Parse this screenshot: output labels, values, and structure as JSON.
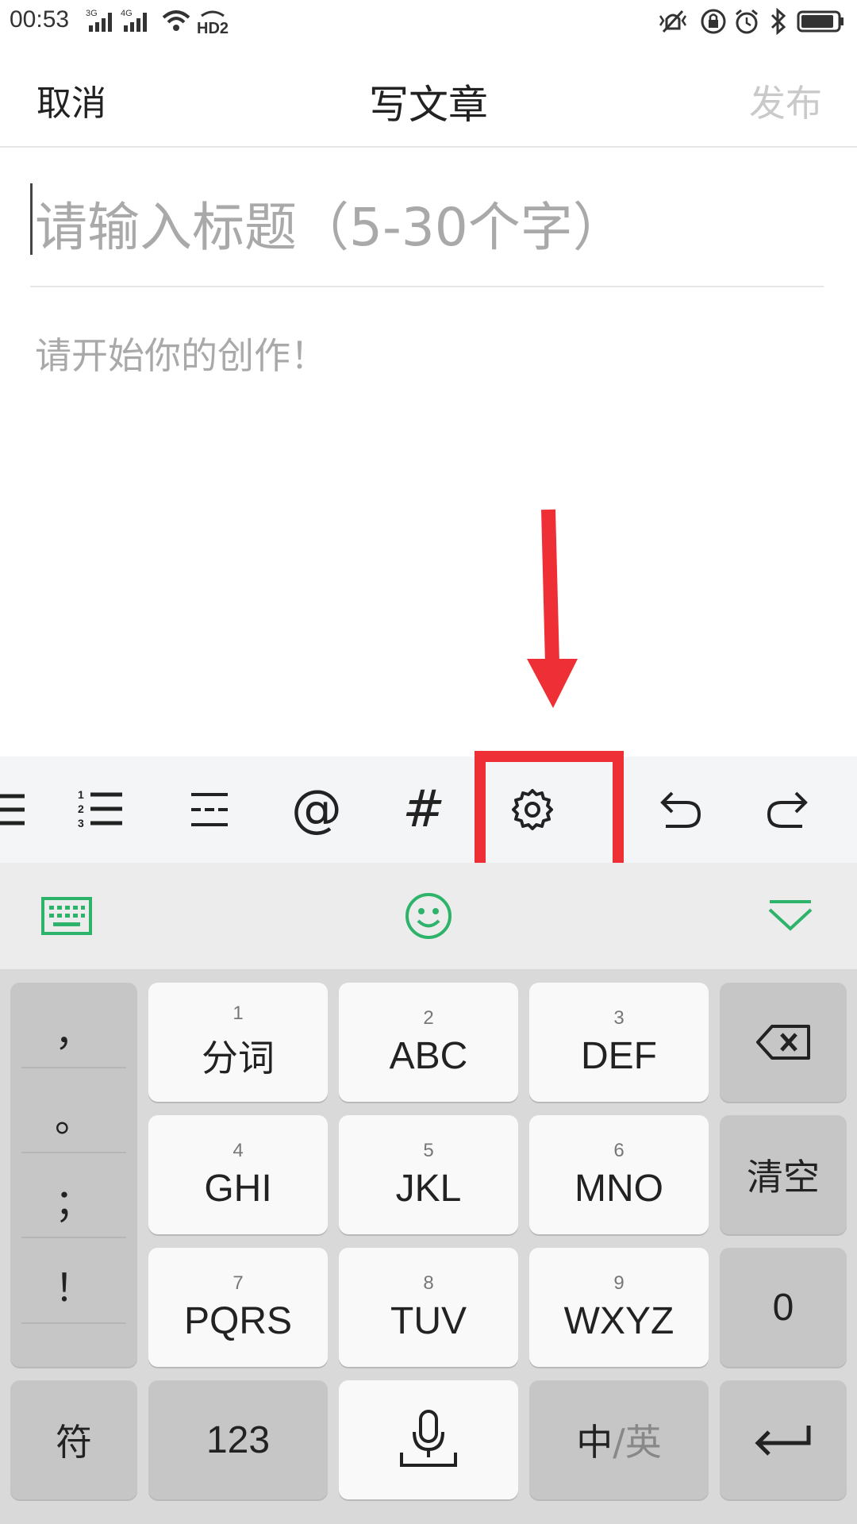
{
  "status_bar": {
    "time": "00:53",
    "icons": [
      "signal-3g-icon",
      "signal-4g-icon",
      "wifi-icon",
      "hd2-icon",
      "vibrate-icon",
      "rotation-lock-icon",
      "alarm-icon",
      "bluetooth-icon",
      "battery-icon"
    ],
    "net1": "3G",
    "net2": "4G",
    "hd": "HD2"
  },
  "header": {
    "cancel_label": "取消",
    "title": "写文章",
    "publish_label": "发布"
  },
  "editor": {
    "title_placeholder": "请输入标题（5-30个字）",
    "body_placeholder": "请开始你的创作！"
  },
  "toolbar": {
    "items": [
      "bullet-list-icon",
      "numbered-list-icon",
      "divider-icon",
      "mention-icon",
      "hashtag-icon",
      "settings-icon",
      "undo-icon",
      "redo-icon"
    ],
    "mention_label": "@",
    "hashtag_label": "#"
  },
  "ime_bar": {
    "items": [
      "keyboard-icon",
      "emoji-icon",
      "collapse-keyboard-icon"
    ],
    "accent_color": "#2db36a"
  },
  "keyboard": {
    "punctuation": [
      "，",
      "。",
      "；",
      "！"
    ],
    "keys": [
      {
        "num": "1",
        "letters": "分词"
      },
      {
        "num": "2",
        "letters": "ABC"
      },
      {
        "num": "3",
        "letters": "DEF"
      },
      {
        "num": "4",
        "letters": "GHI"
      },
      {
        "num": "5",
        "letters": "JKL"
      },
      {
        "num": "6",
        "letters": "MNO"
      },
      {
        "num": "7",
        "letters": "PQRS"
      },
      {
        "num": "8",
        "letters": "TUV"
      },
      {
        "num": "9",
        "letters": "WXYZ"
      }
    ],
    "clear_label": "清空",
    "zero_label": "0",
    "symbol_label": "符",
    "numbers_label": "123",
    "lang_cn": "中",
    "lang_sep": "/",
    "lang_en": "英"
  },
  "annotation": {
    "highlight_color": "#ee2f35"
  }
}
